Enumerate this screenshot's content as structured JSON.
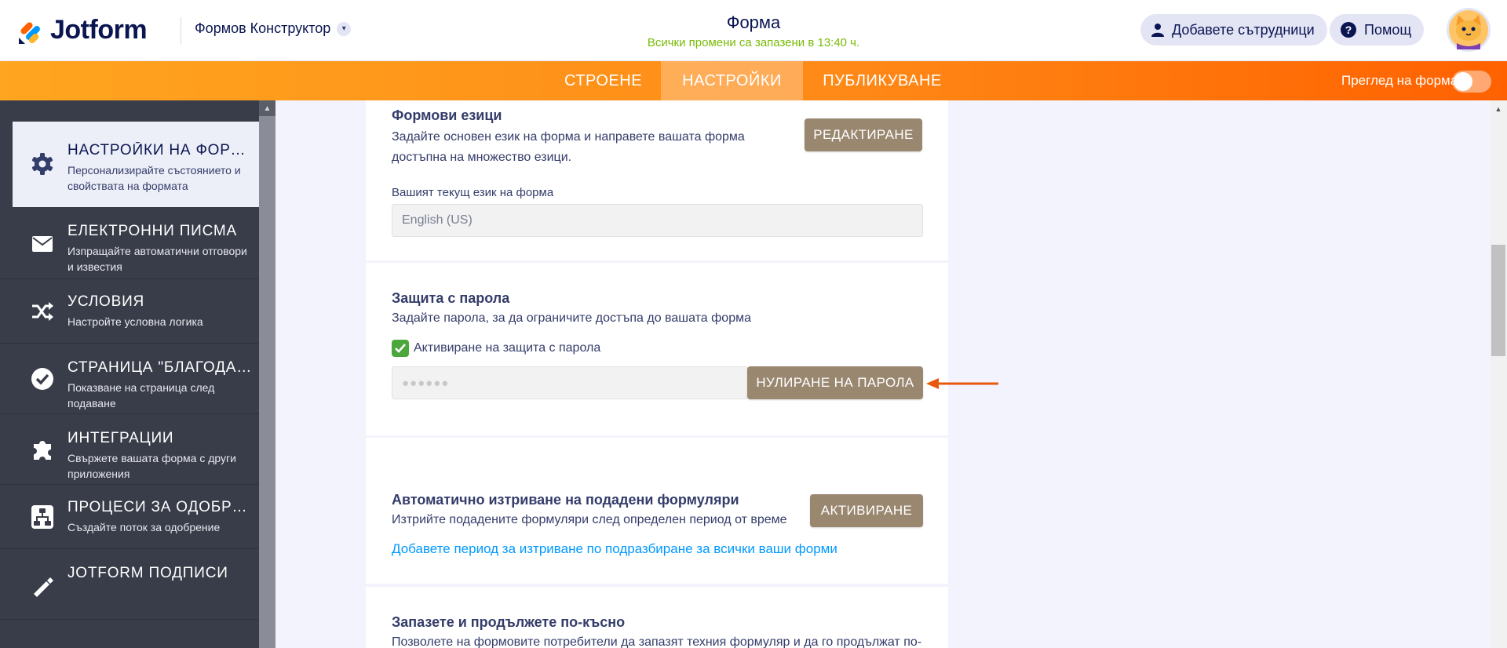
{
  "header": {
    "logo_text": "Jotform",
    "builder_label": "Формов Конструктор",
    "form_title": "Форма",
    "save_status": "Всички промени са запазени в 13:40 ч.",
    "collaborators_label": "Добавете сътрудници",
    "help_label": "Помощ"
  },
  "nav": {
    "tabs": [
      {
        "label": "СТРОЕНЕ",
        "active": false
      },
      {
        "label": "НАСТРОЙКИ",
        "active": true
      },
      {
        "label": "ПУБЛИКУВАНЕ",
        "active": false
      }
    ],
    "preview_label": "Преглед на форма",
    "preview_enabled": false
  },
  "sidebar": {
    "items": [
      {
        "title": "НАСТРОЙКИ НА ФОРМ...",
        "desc": "Персонализирайте състоянието и свойствата на формата",
        "icon": "gear-icon",
        "active": true
      },
      {
        "title": "ЕЛЕКТРОННИ ПИСМА",
        "desc": "Изпращайте автоматични отговори и известия",
        "icon": "envelope-icon"
      },
      {
        "title": "УСЛОВИЯ",
        "desc": "Настройте условна логика",
        "icon": "shuffle-icon"
      },
      {
        "title": "СТРАНИЦА \"БЛАГОДАРЯ\"",
        "desc": "Показване на страница след подаване",
        "icon": "check-circle-icon"
      },
      {
        "title": "ИНТЕГРАЦИИ",
        "desc": "Свържете вашата форма с други приложения",
        "icon": "puzzle-icon"
      },
      {
        "title": "ПРОЦЕСИ ЗА ОДОБРЕН...",
        "desc": "Създайте поток за одобрение",
        "icon": "flow-icon"
      },
      {
        "title": "JOTFORM ПОДПИСИ",
        "desc": "",
        "icon": "signature-icon"
      }
    ]
  },
  "languages": {
    "title": "Формови езици",
    "desc": "Задайте основен език на форма и направете вашата форма достъпна на множество езици.",
    "edit_button": "РЕДАКТИРАНЕ",
    "current_label": "Вашият текущ език на форма",
    "current_value": "English (US)"
  },
  "password": {
    "title": "Защита с парола",
    "desc": "Задайте парола, за да ограничите достъпа до вашата форма",
    "enable_label": "Активиране на защита с парола",
    "enabled": true,
    "masked_value": "●●●●●●",
    "reset_button": "НУЛИРАНЕ НА ПАРОЛА"
  },
  "auto_delete": {
    "title": "Автоматично изтриване на подадени формуляри",
    "desc": "Изтрийте подадените формуляри след определен период от време",
    "activate_button": "АКТИВИРАНЕ",
    "link": "Добавете период за изтриване по подразбиране за всички ваши форми"
  },
  "save_continue": {
    "title": "Запазете и продължете по-късно",
    "desc": "Позволете на формовите потребители да запазят техния формуляр и да го продължат по-"
  },
  "colors": {
    "orange_accent": "#ff6100",
    "brown_button": "#9a8770",
    "sidebar_bg": "#393d4a",
    "link_blue": "#0099ff",
    "saved_green": "#78bb07"
  }
}
